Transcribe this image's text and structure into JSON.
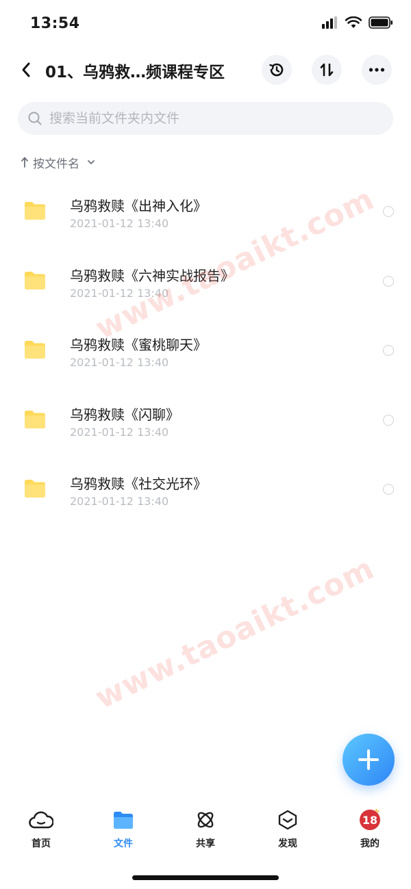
{
  "status_bar": {
    "time": "13:54",
    "icons": [
      "signal-icon",
      "wifi-icon",
      "battery-icon"
    ]
  },
  "nav": {
    "back_icon": "chevron-left-icon",
    "title": "01、乌鸦救…频课程专区",
    "actions": [
      "history-icon",
      "sort-arrows-icon",
      "more-icon"
    ]
  },
  "search": {
    "placeholder": "搜索当前文件夹内文件",
    "value": ""
  },
  "sort": {
    "label": "按文件名"
  },
  "files": [
    {
      "name": "乌鸦救赎《出神入化》",
      "date": "2021-01-12 13:40"
    },
    {
      "name": "乌鸦救赎《六神实战报告》",
      "date": "2021-01-12 13:40"
    },
    {
      "name": "乌鸦救赎《蜜桃聊天》",
      "date": "2021-01-12 13:40"
    },
    {
      "name": "乌鸦救赎《闪聊》",
      "date": "2021-01-12 13:40"
    },
    {
      "name": "乌鸦救赎《社交光环》",
      "date": "2021-01-12 13:40"
    }
  ],
  "watermarks": [
    "www.taoaikt.com",
    "www.taoaikt.com"
  ],
  "tabs": [
    {
      "label": "首页",
      "icon": "cloud-icon",
      "active": false
    },
    {
      "label": "文件",
      "icon": "folder-icon",
      "active": true
    },
    {
      "label": "共享",
      "icon": "share-atom-icon",
      "active": false
    },
    {
      "label": "发现",
      "icon": "discover-box-icon",
      "active": false
    },
    {
      "label": "我的",
      "icon": "avatar-icon",
      "active": false
    }
  ],
  "avatar_text": "18",
  "colors": {
    "accent": "#2f8cf5",
    "folder": "#ffd95a",
    "fab_start": "#5cc8ff",
    "fab_end": "#2f86f6",
    "avatar": "#d9333a"
  }
}
